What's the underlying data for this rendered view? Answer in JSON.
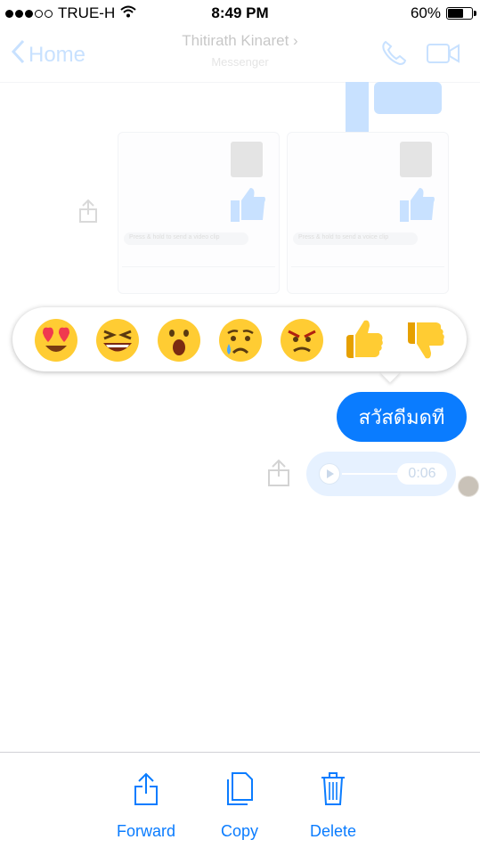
{
  "status_bar": {
    "carrier": "TRUE-H",
    "time": "8:49 PM",
    "battery": "60%",
    "battery_level": 0.6
  },
  "nav": {
    "back_label": "Home",
    "title": "Thitirath Kinaret",
    "subtitle": "Messenger"
  },
  "background_cards": {
    "hint_video": "Press & hold to send a video clip",
    "hint_voice": "Press & hold to send a voice clip"
  },
  "reactions": [
    {
      "name": "love",
      "icon": "heart-eyes-emoji"
    },
    {
      "name": "haha",
      "icon": "laughing-emoji"
    },
    {
      "name": "wow",
      "icon": "surprised-emoji"
    },
    {
      "name": "sad",
      "icon": "crying-emoji"
    },
    {
      "name": "angry",
      "icon": "angry-emoji"
    },
    {
      "name": "like",
      "icon": "thumbs-up-icon"
    },
    {
      "name": "dislike",
      "icon": "thumbs-down-icon"
    }
  ],
  "messages": {
    "text_message": "สวัสดีมดที",
    "audio_duration": "0:06"
  },
  "toolbar": {
    "forward": "Forward",
    "copy": "Copy",
    "delete": "Delete"
  },
  "colors": {
    "accent": "#0a7cff",
    "emoji_yellow": "#ffcc33"
  }
}
